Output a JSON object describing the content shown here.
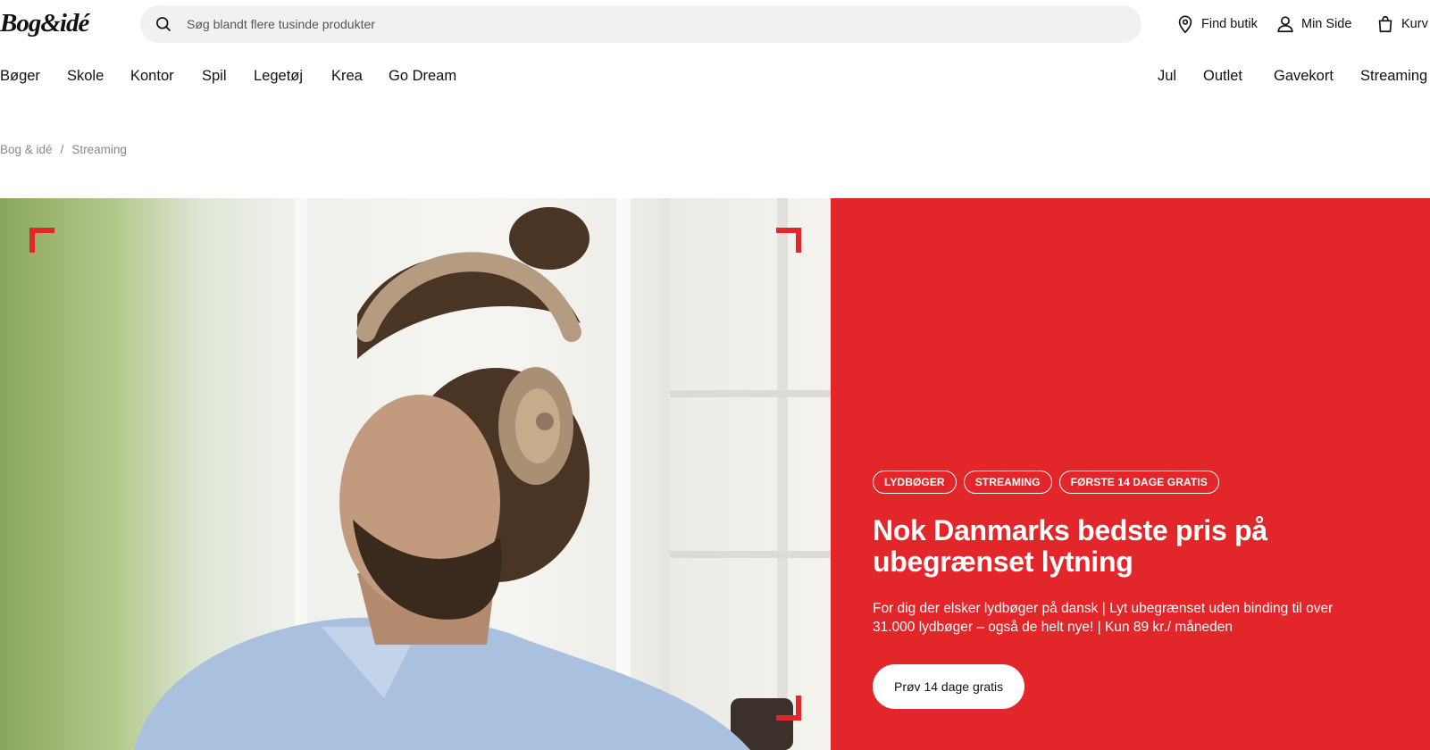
{
  "header": {
    "logo_text": "Bog&idé",
    "search": {
      "placeholder": "Søg blandt flere tusinde produkter",
      "icon": "search-icon"
    },
    "utilities": [
      {
        "label": "Find butik",
        "icon": "location-pin-icon"
      },
      {
        "label": "Min Side",
        "icon": "user-icon"
      },
      {
        "label": "Kurv",
        "icon": "shopping-bag-icon"
      }
    ]
  },
  "nav": {
    "left": [
      "Bøger",
      "Skole",
      "Kontor",
      "Spil",
      "Legetøj",
      "Krea",
      "Go Dream"
    ],
    "right": [
      "Jul",
      "Outlet",
      "Gavekort",
      "Streaming"
    ]
  },
  "breadcrumb": {
    "items": [
      "Bog & idé",
      "Streaming"
    ],
    "separator": "/"
  },
  "hero": {
    "image_alt": "Man wearing beige over-ear headphones, listening",
    "accent_color": "#e2262a",
    "tags": [
      "LYDBØGER",
      "STREAMING",
      "FØRSTE 14 DAGE GRATIS"
    ],
    "title": "Nok Danmarks bedste pris på ubegrænset lytning",
    "description": "For dig der elsker lydbøger på dansk | Lyt ubegrænset uden binding til over 31.000 lydbøger – også de helt nye! | Kun 89 kr./ måneden",
    "cta_label": "Prøv 14 dage gratis"
  }
}
